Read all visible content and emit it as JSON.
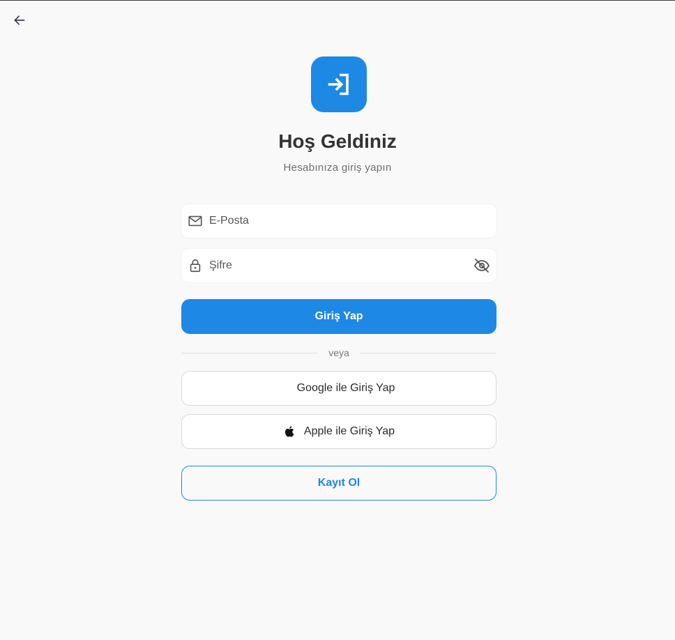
{
  "header": {
    "back_icon": "arrow-left-icon"
  },
  "logo": {
    "icon": "login-icon",
    "color": "#1e88e5"
  },
  "hero": {
    "title": "Hoş Geldiniz",
    "subtitle": "Hesabınıza giriş yapın"
  },
  "form": {
    "email": {
      "placeholder": "E-Posta",
      "value": "",
      "icon": "mail-icon"
    },
    "password": {
      "placeholder": "Şifre",
      "value": "",
      "icon": "lock-icon",
      "toggle_icon": "eye-off-icon"
    },
    "submit_label": "Giriş Yap"
  },
  "divider": {
    "text": "veya"
  },
  "social": {
    "google_label": "Google ile Giriş Yap",
    "apple_label": "Apple ile Giriş Yap",
    "apple_icon": "apple-logo-icon"
  },
  "register": {
    "label": "Kayıt Ol"
  },
  "colors": {
    "primary": "#1e88e5",
    "background": "#f9f9fa"
  }
}
